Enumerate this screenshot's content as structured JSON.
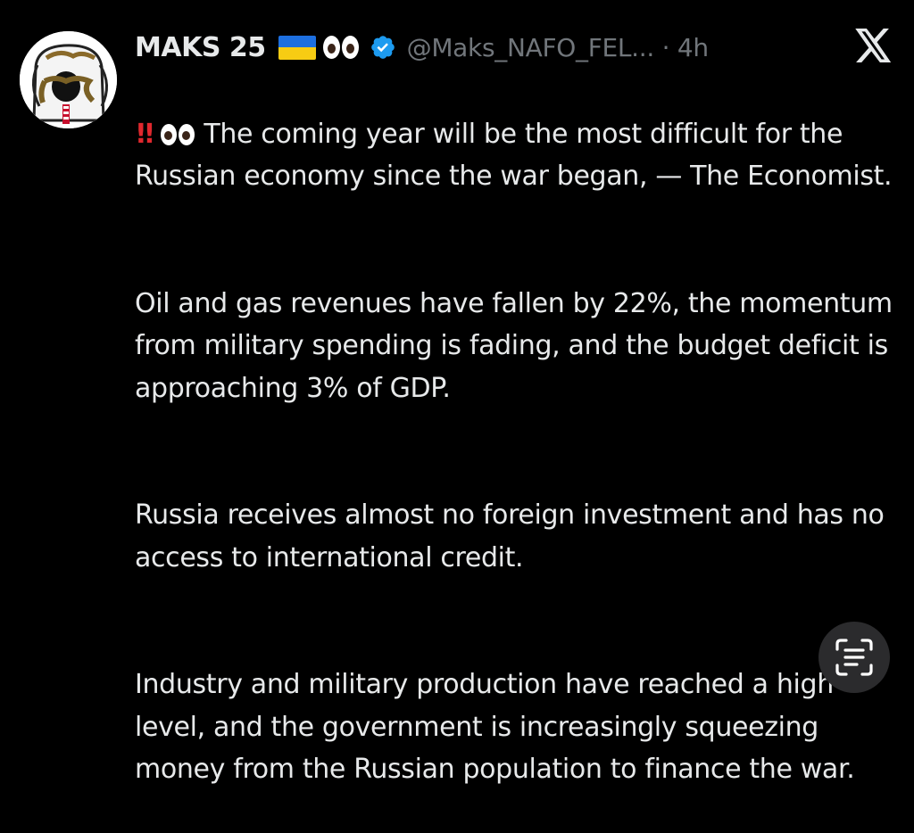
{
  "tweet": {
    "author": {
      "display_name": "MAKS 25",
      "flag": "ukraine-flag",
      "emoji": "eyes-emoji",
      "verified": true,
      "handle": "@Maks_NAFO_FEL...",
      "separator": "·",
      "time": "4h"
    },
    "body": {
      "lead_emoji_bangs": "‼️",
      "line1": "The coming year will be the most difficult for the Russian economy since the war began, — The Economist.",
      "p2": "Oil and gas revenues have fallen by 22%, the momentum from military spending is fading, and the budget deficit is approaching 3% of GDP.",
      "p3": "Russia receives almost no foreign investment and has no access to international credit.",
      "p4": "Industry and military production have reached a high level, and the government is increasingly squeezing money from the Russian population to finance the war."
    }
  },
  "icons": {
    "platform_logo": "x-logo-icon",
    "overlay_button": "text-scan-icon"
  },
  "colors": {
    "background": "#000000",
    "text_primary": "#e7e9ea",
    "text_secondary": "#71767b",
    "verified": "#1d9bf0",
    "bangs": "#e0282e"
  }
}
